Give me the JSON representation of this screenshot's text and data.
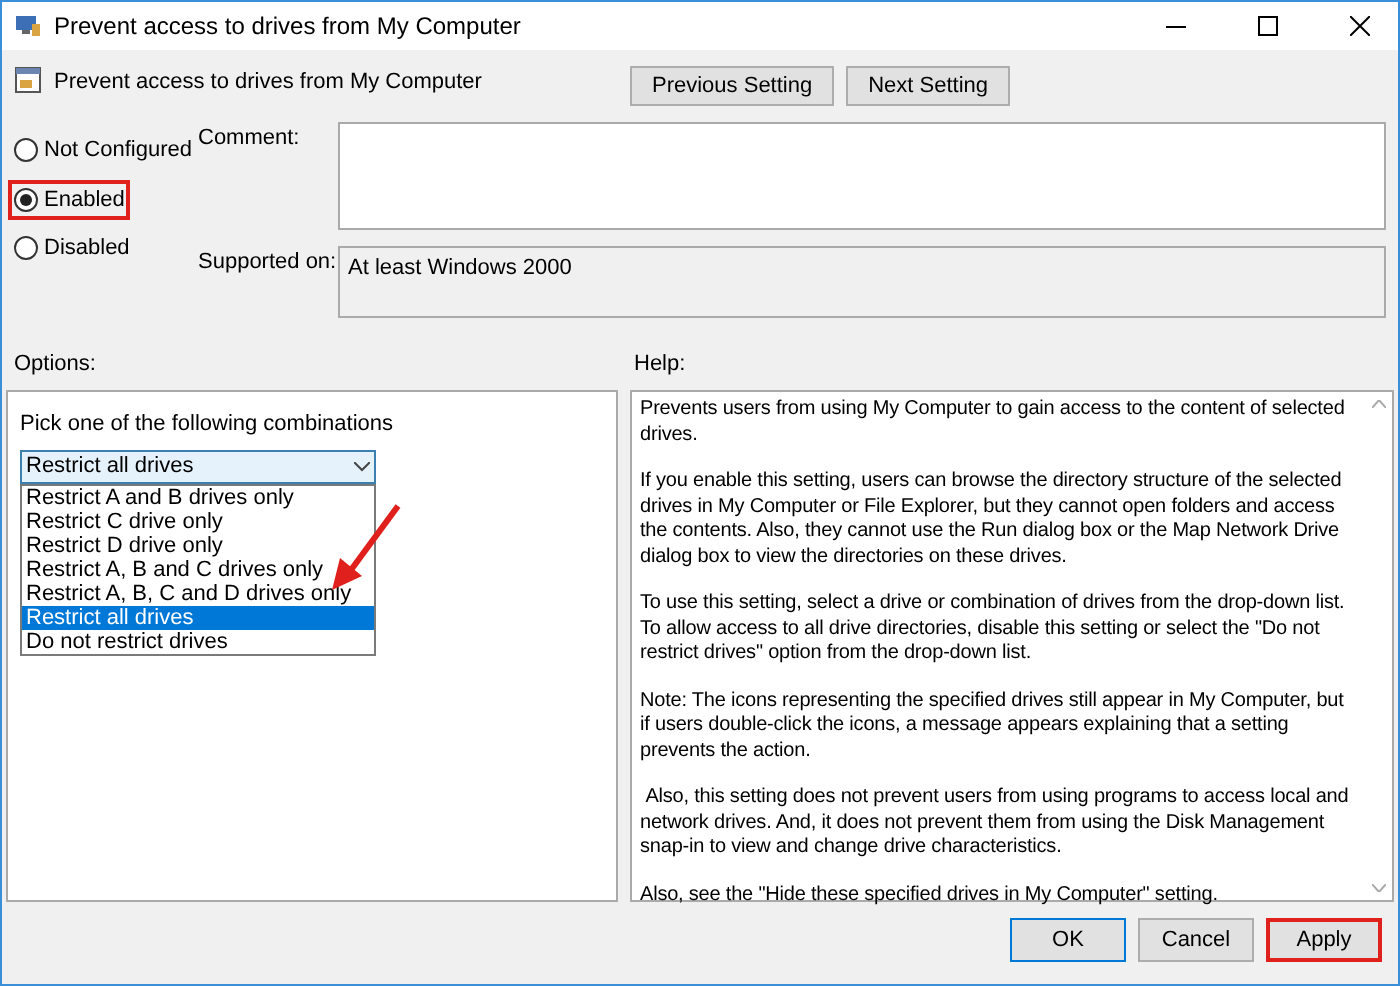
{
  "window": {
    "title": "Prevent access to drives from My Computer"
  },
  "header": {
    "setting_name": "Prevent access to drives from My Computer",
    "buttons": [
      "Previous Setting",
      "Next Setting"
    ]
  },
  "state_options": [
    {
      "label": "Not Configured",
      "selected": false
    },
    {
      "label": "Enabled",
      "selected": true
    },
    {
      "label": "Disabled",
      "selected": false
    }
  ],
  "comment": {
    "label": "Comment:"
  },
  "supported_on": {
    "label": "Supported on:",
    "value": "At least Windows 2000"
  },
  "options": {
    "label": "Options:",
    "prompt": "Pick one of the following combinations",
    "dropdown": {
      "value": "Restrict all drives",
      "expanded": true,
      "items": [
        {
          "label": "Restrict A and B drives only",
          "selected": false
        },
        {
          "label": "Restrict C drive only",
          "selected": false
        },
        {
          "label": "Restrict D drive only",
          "selected": false
        },
        {
          "label": "Restrict A, B and C drives only",
          "selected": false
        },
        {
          "label": "Restrict A, B, C and D drives only",
          "selected": false
        },
        {
          "label": "Restrict all drives",
          "selected": true
        },
        {
          "label": "Do not restrict drives",
          "selected": false
        }
      ]
    }
  },
  "help": {
    "label": "Help:",
    "paragraphs": [
      "Prevents users from using My Computer to gain access to the content of selected drives.",
      "If you enable this setting, users can browse the directory structure of the selected drives in My Computer or File Explorer, but they cannot open folders and access the contents. Also, they cannot use the Run dialog box or the Map Network Drive dialog box to view the directories on these drives.",
      "To use this setting, select a drive or combination of drives from the drop-down list. To allow access to all drive directories, disable this setting or select the \"Do not restrict drives\" option from the drop-down list.",
      "Note: The icons representing the specified drives still appear in My Computer, but if users double-click the icons, a message appears explaining that a setting prevents the action.",
      " Also, this setting does not prevent users from using programs to access local and network drives. And, it does not prevent them from using the Disk Management snap-in to view and change drive characteristics.",
      "Also, see the \"Hide these specified drives in My Computer\" setting."
    ]
  },
  "footer_buttons": [
    {
      "label": "OK",
      "kind": "default"
    },
    {
      "label": "Cancel",
      "kind": "normal"
    },
    {
      "label": "Apply",
      "kind": "highlighted"
    }
  ]
}
